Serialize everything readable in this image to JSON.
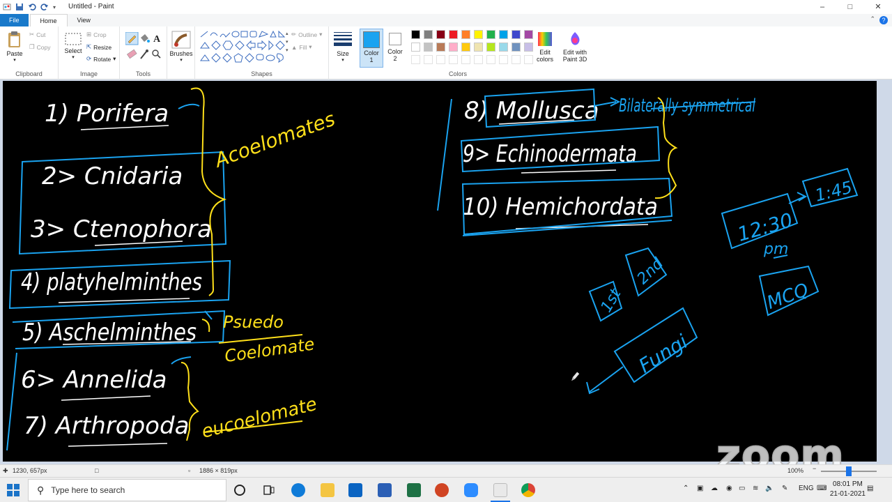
{
  "window": {
    "title": "Untitled - Paint",
    "controls": {
      "minimize": "–",
      "maximize": "□",
      "close": "✕"
    }
  },
  "tabs": [
    "File",
    "Home",
    "View"
  ],
  "ribbon": {
    "clipboard": {
      "label": "Clipboard",
      "paste": "Paste",
      "cut": "Cut",
      "copy": "Copy"
    },
    "image": {
      "label": "Image",
      "select": "Select",
      "crop": "Crop",
      "resize": "Resize",
      "rotate": "Rotate"
    },
    "tools": {
      "label": "Tools"
    },
    "brushes": {
      "label": "Brushes"
    },
    "shapes": {
      "label": "Shapes",
      "outline": "Outline",
      "fill": "Fill"
    },
    "size": {
      "label": "Size"
    },
    "color1": {
      "line1": "Color",
      "line2": "1",
      "value": "#1aa3f0"
    },
    "color2": {
      "line1": "Color",
      "line2": "2"
    },
    "colors": {
      "label": "Colors",
      "row1": [
        "#000000",
        "#7f7f7f",
        "#880015",
        "#ed1c24",
        "#ff7f27",
        "#fff200",
        "#22b14c",
        "#00a2e8",
        "#3f48cc",
        "#a349a4"
      ],
      "row2": [
        "#ffffff",
        "#c3c3c3",
        "#b97a57",
        "#ffaec9",
        "#ffc90e",
        "#efe4b0",
        "#b5e61d",
        "#99d9ea",
        "#7092be",
        "#c8bfe7"
      ]
    },
    "edit_colors": {
      "line1": "Edit",
      "line2": "colors"
    },
    "paint3d": {
      "line1": "Edit with",
      "line2": "Paint 3D"
    }
  },
  "canvas_text": {
    "porifera": "1) Porifera",
    "cnidaria": "2> Cnidaria",
    "ctenophora": "3> Ctenophora",
    "platyhelminthes": "4) platyhelminthes",
    "aschelminthes": "5) Aschelminthes",
    "annelida": "6> Annelida",
    "arthropoda": "7) Arthropoda",
    "mollusca": "8) Mollusca",
    "echinodermata": "9> Echinodermata",
    "hemichordata": "10) Hemichordata",
    "acoelomates": "Acoelomates",
    "pseudo": "Psuedo",
    "coelomate": "Coelomate",
    "eucoelomate": "eucoelomate",
    "bilateral": "Bilaterally symmetrical",
    "time1": "12:30",
    "time2": "1:45",
    "pm": "pm",
    "mcq": "MCQ",
    "first": "1st",
    "second": "2nd",
    "fungi": "Fungi"
  },
  "status": {
    "cursor": "1230, 657px",
    "size": "1886 × 819px",
    "zoom": "100%"
  },
  "watermark": "zoom",
  "taskbar": {
    "search_placeholder": "Type here to search",
    "language": "ENG",
    "time": "08:01 PM",
    "date": "21-01-2021"
  }
}
